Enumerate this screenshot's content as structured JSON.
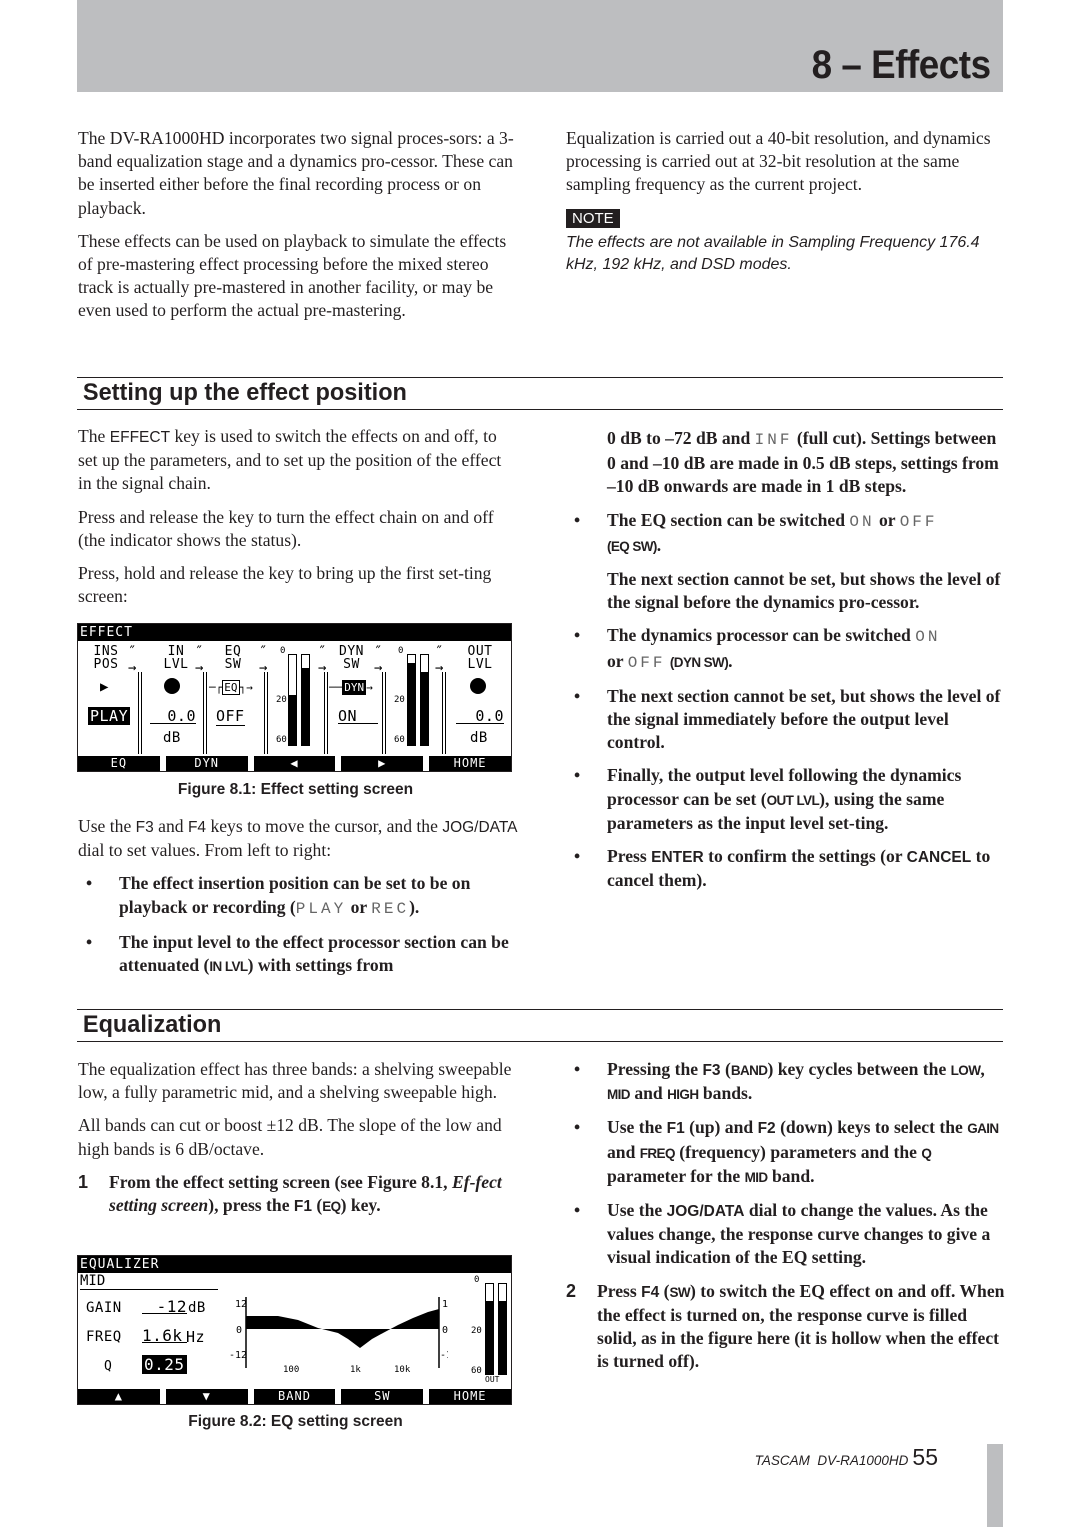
{
  "header": {
    "chapter_title": "8 – Effects"
  },
  "intro": {
    "left_paragraphs": [
      "The DV-RA1000HD incorporates two signal proces-sors: a 3-band equalization stage and a dynamics pro-cessor. These can be inserted either before the final recording process or on playback.",
      "These effects can be used on playback to simulate the effects of pre-mastering effect processing before the mixed stereo track is actually pre-mastered in another facility, or may be even used to perform the actual pre-mastering."
    ],
    "right_paragraph": "Equalization is carried out a 40-bit resolution, and dynamics processing is carried out at 32-bit resolution at the same sampling frequency as the current project.",
    "note_label": "NOTE",
    "note_text": "The effects are not available in Sampling Frequency 176.4 kHz, 192 kHz, and DSD modes."
  },
  "section1": {
    "title": "Setting up the effect position",
    "p1_pre": "The ",
    "p1_key": "EFFECT",
    "p1_post": " key is used to switch the effects on and off, to set up the parameters, and to set up the position of the effect in the signal chain.",
    "p2": "Press and release the key to turn the effect chain on and off (the indicator shows the status).",
    "p3": "Press, hold and release the key to bring up the first set-ting screen:",
    "figure_caption": "Figure 8.1: Effect setting screen",
    "p4_a": "Use the ",
    "p4_f3": "F3",
    "p4_b": " and ",
    "p4_f4": "F4",
    "p4_c": " keys to move the cursor, and the ",
    "p4_jog": "JOG/DATA",
    "p4_d": " dial to set values. From left to right:",
    "b1_a": "The effect insertion position can be set to be on playback or recording (",
    "b1_play": "PLAY",
    "b1_or": " or ",
    "b1_rec": "REC",
    "b1_end": ").",
    "b2_a": "The input level to the effect processor section can be attenuated (",
    "b2_code": "IN LVL",
    "b2_b": ") with settings from",
    "r1_a": "0 dB to –72 dB and ",
    "r1_inf": "INF",
    "r1_b": " (full cut). Settings between 0 and –10 dB are made in 0.5 dB steps, settings from –10 dB onwards are made in 1 dB steps.",
    "b3_a": "The EQ section can be switched ",
    "b3_on": "ON",
    "b3_or": " or ",
    "b3_off": "OFF",
    "b3_code": "(EQ SW)",
    "b3_end": ".",
    "r2": "The next section cannot be set, but shows the level of the signal before the dynamics pro-cessor.",
    "b4_a": "The dynamics processor can be switched ",
    "b4_on": "ON",
    "b4_or": "or ",
    "b4_off": "OFF",
    "b4_code": "(DYN SW)",
    "b4_end": ".",
    "b5": "The next section cannot be set, but shows the level of the signal immediately before the output level control.",
    "b6_a": "Finally, the output level following the dynamics processor can be set (",
    "b6_code": "OUT LVL",
    "b6_b": "), using the same parameters as the input level set-ting.",
    "b7_a": "Press ",
    "b7_enter": "ENTER",
    "b7_b": " to confirm the settings (or ",
    "b7_cancel": "CANCEL",
    "b7_c": " to cancel them)."
  },
  "effect_screen": {
    "title": "EFFECT",
    "columns": [
      {
        "l1": "INS",
        "l2": "POS",
        "value": "PLAY",
        "unit": ""
      },
      {
        "l1": "IN",
        "l2": "LVL",
        "value": "0.0",
        "unit": "dB"
      },
      {
        "l1": "EQ",
        "l2": "SW",
        "value": "OFF",
        "block": "EQ"
      },
      {
        "l1": "DYN",
        "l2": "SW",
        "value": "ON",
        "block": "DYN"
      },
      {
        "l1": "OUT",
        "l2": "LVL",
        "value": "0.0",
        "unit": "dB"
      }
    ],
    "meter_scale": [
      "0",
      "20",
      "60"
    ],
    "pre_dyn_meter_levels": [
      0.55,
      0.85
    ],
    "pre_out_meter_levels": [
      0.9,
      0.8
    ],
    "fkeys": [
      "EQ",
      "DYN",
      "◀",
      "▶",
      "HOME"
    ]
  },
  "section2": {
    "title": "Equalization",
    "p1": "The equalization effect has three bands: a shelving sweepable low, a fully parametric mid, and a shelving sweepable high.",
    "p2": "All bands can cut or boost ±12 dB. The slope of the low and high bands is 6 dB/octave.",
    "s1_num": "1",
    "s1_a": "From the effect setting screen (see Figure 8.1, ",
    "s1_italic": "Ef-fect setting screen",
    "s1_b": "), press the ",
    "s1_f1": "F1",
    "s1_c": " (",
    "s1_eq": "EQ",
    "s1_d": ") key.",
    "figure_caption": "Figure 8.2: EQ setting screen",
    "rb1_a": "Pressing the ",
    "rb1_f3": "F3",
    "rb1_b": " (",
    "rb1_band": "BAND",
    "rb1_c": ") key cycles between the ",
    "rb1_low": "LOW",
    "rb1_d": ", ",
    "rb1_mid": "MID",
    "rb1_e": " and ",
    "rb1_high": "HIGH",
    "rb1_f": " bands.",
    "rb2_a": "Use the ",
    "rb2_f1": "F1",
    "rb2_b": " (up) and ",
    "rb2_f2": "F2",
    "rb2_c": " (down) keys to select the ",
    "rb2_gain": "GAIN",
    "rb2_d": " and ",
    "rb2_freq": "FREQ",
    "rb2_e": " (frequency) parameters and the ",
    "rb2_q": "Q",
    "rb2_f": " parameter for the ",
    "rb2_mid": "MID",
    "rb2_g": " band.",
    "rb3_a": "Use the ",
    "rb3_jog": "JOG/DATA",
    "rb3_b": " dial to change the values. As the values change, the response curve changes to give a visual indication of the EQ setting.",
    "s2_num": "2",
    "s2_a": "Press ",
    "s2_f4": "F4",
    "s2_b": " (",
    "s2_sw": "SW",
    "s2_c": ") to switch the EQ effect on and off. When the effect is turned on, the response curve is filled solid, as in the figure here (it is hollow when the effect is turned off)."
  },
  "eq_screen": {
    "title": "EQUALIZER",
    "band": "MID",
    "params": [
      {
        "label": "GAIN",
        "value": "-12",
        "unit": "dB"
      },
      {
        "label": "FREQ",
        "value": "1.6k",
        "unit": "Hz"
      },
      {
        "label": "Q",
        "value": "0.25",
        "unit": ""
      }
    ],
    "graph_y_labels": [
      "12",
      "0",
      "-12"
    ],
    "graph_x_labels": [
      "100",
      "1k",
      "10k"
    ],
    "meter_scale": [
      "0",
      "20",
      "60"
    ],
    "meter_label": "OUT",
    "meter_levels": [
      0.8,
      0.8
    ],
    "fkeys": [
      "▲",
      "▼",
      "BAND",
      "SW",
      "HOME"
    ]
  },
  "footer": {
    "brand": "TASCAM",
    "model": "DV-RA1000HD",
    "page": "55"
  }
}
